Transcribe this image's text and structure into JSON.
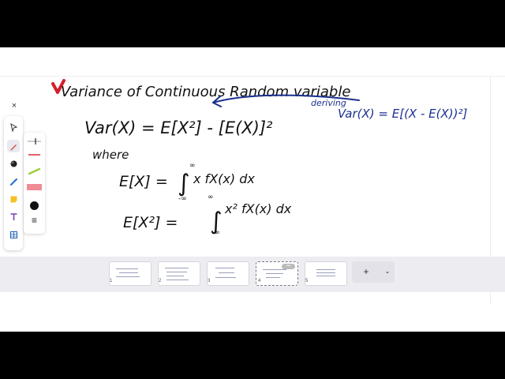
{
  "colors": {
    "ink": "#111111",
    "note_ink": "#1b2f8f",
    "bullet": "#d4202a",
    "accent_red": "#e04a4a",
    "strip_bg": "#ededf1"
  },
  "whiteboard": {
    "title": "Variance of Continuous Random variable",
    "formula": "Var(X) = E[X²] - [E(X)]²",
    "note_word": "deriving",
    "note_formula": "Var(X) = E[(X - E(X))²]",
    "where_label": "where",
    "ex_left": "E[X] =",
    "ex_integrand": "x fX(x) dx",
    "ex2_left": "E[X²] =",
    "ex2_integrand": "x² fX(x) dx",
    "limit_upper": "∞",
    "limit_lower": "-∞"
  },
  "toolbar": {
    "close_icon": "×",
    "tools": [
      "pointer-icon",
      "pen-icon",
      "eraser-icon",
      "marker-icon",
      "sticky-note-icon",
      "text-icon",
      "table-icon"
    ],
    "active_tool": "pen-icon",
    "menu_icon": "≡"
  },
  "pages": {
    "numbers": [
      "1",
      "2",
      "3",
      "4",
      "5"
    ],
    "selected": "4",
    "more_badge": "•••",
    "add_icon": "+",
    "dropdown_icon": "⌄"
  }
}
